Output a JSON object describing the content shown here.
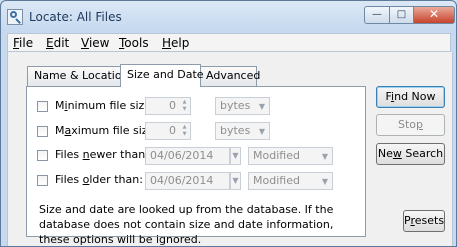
{
  "window": {
    "title": "Locate: All Files"
  },
  "caption_buttons": {
    "minimize": "▭",
    "maximize": "□",
    "close": "✕"
  },
  "menu": {
    "items": [
      {
        "key": "F",
        "rest": "ile"
      },
      {
        "key": "E",
        "rest": "dit"
      },
      {
        "key": "V",
        "rest": "iew"
      },
      {
        "key": "T",
        "rest": "ools"
      },
      {
        "key": "H",
        "rest": "elp"
      }
    ]
  },
  "tabs": [
    "Name & Location",
    "Size and Date",
    "Advanced"
  ],
  "rows": {
    "min_size": {
      "pre": "M",
      "key": "i",
      "post": "nimum file size:",
      "value": "0",
      "unit": "bytes"
    },
    "max_size": {
      "pre": "M",
      "key": "a",
      "post": "ximum file size:",
      "value": "0",
      "unit": "bytes"
    },
    "newer": {
      "pre": "Files ",
      "key": "n",
      "post": "ewer than:",
      "date": "04/06/2014",
      "mode": "Modified"
    },
    "older": {
      "pre": "Files ",
      "key": "o",
      "post": "lder than:",
      "date": "04/06/2014",
      "mode": "Modified"
    }
  },
  "info": "Size and date are looked up from the database. If the database does not contain size and date information, these options will be ignored.",
  "buttons": {
    "find_now": {
      "pre": "F",
      "key": "i",
      "post": "nd Now"
    },
    "stop": {
      "pre": "Sto",
      "key": "p",
      "post": ""
    },
    "new_search": {
      "pre": "Ne",
      "key": "w",
      "post": " Search"
    },
    "presets": {
      "pre": "P",
      "key": "r",
      "post": "esets"
    }
  },
  "colors": {
    "accent": "#3c7fb1",
    "close": "#c7432b",
    "window": "#cfe0f2"
  }
}
